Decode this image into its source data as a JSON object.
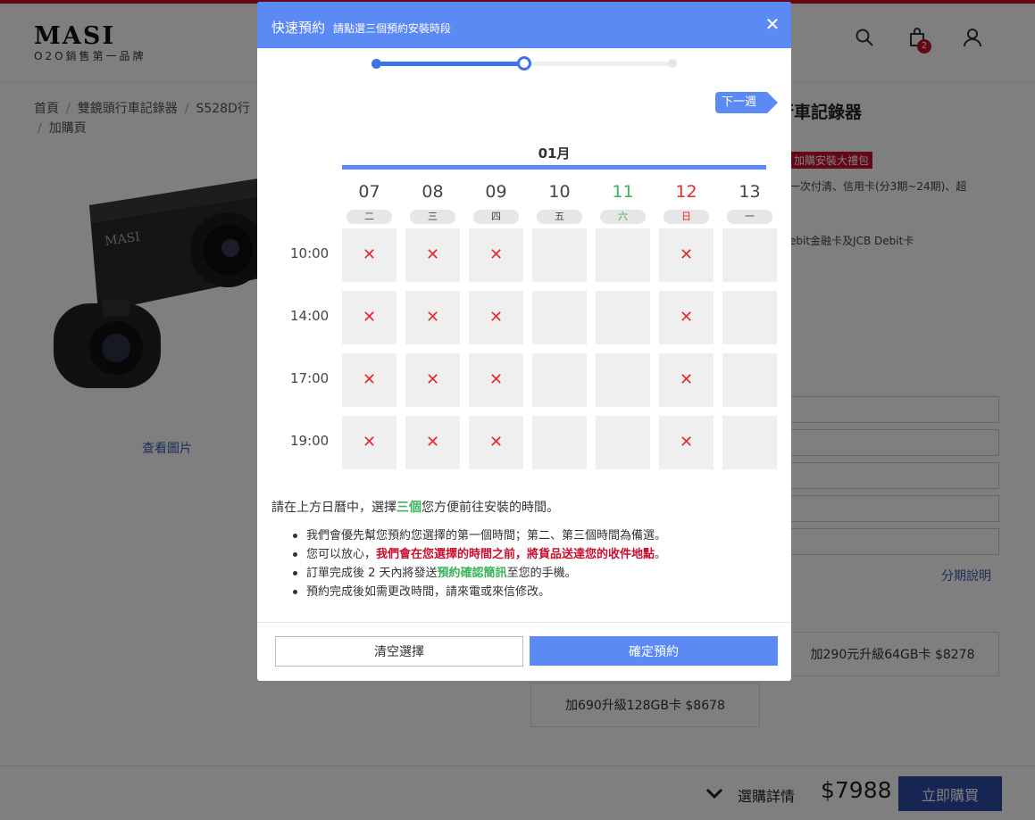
{
  "site": {
    "logo_text": "MASI",
    "logo_sub": "O2O銷售第一品牌",
    "cart_count": "2"
  },
  "breadcrumb": {
    "home": "首頁",
    "category": "雙鏡頭行車記錄器",
    "product": "S528D行",
    "current": "加購頁"
  },
  "product": {
    "view_photos": "查看圖片",
    "title": "行車記錄器",
    "promo": "加購安裝大禮包",
    "payment_note1": "一次付清、信用卡(分3期~24期)、超",
    "payment_note2": "ebit金融卡及JCB Debit卡",
    "installment_link": "分期說明",
    "option_64": "加290元升級64GB卡 $8278",
    "option_128": "加690升級128GB卡 $8678"
  },
  "bottom_bar": {
    "details_label": "選購詳情",
    "total": "$7988",
    "buy_now": "立即購買"
  },
  "modal": {
    "title": "快速預約",
    "subtitle": "請點選三個預約安裝時段",
    "close_symbol": "✕",
    "progress_fraction": 0.5,
    "next_week": "下一週",
    "month": "01月",
    "days": [
      {
        "num": "07",
        "weekday": "二",
        "color": "#444444"
      },
      {
        "num": "08",
        "weekday": "三",
        "color": "#444444"
      },
      {
        "num": "09",
        "weekday": "四",
        "color": "#444444"
      },
      {
        "num": "10",
        "weekday": "五",
        "color": "#444444"
      },
      {
        "num": "11",
        "weekday": "六",
        "color": "#3bb35b"
      },
      {
        "num": "12",
        "weekday": "日",
        "color": "#e52b2b"
      },
      {
        "num": "13",
        "weekday": "一",
        "color": "#444444"
      }
    ],
    "times": [
      "10:00",
      "14:00",
      "17:00",
      "19:00"
    ],
    "unavailable_mark": "✕",
    "unavailable": [
      [
        true,
        true,
        true,
        false,
        false,
        true,
        false
      ],
      [
        true,
        true,
        true,
        false,
        false,
        true,
        false
      ],
      [
        true,
        true,
        true,
        false,
        false,
        true,
        false
      ],
      [
        true,
        true,
        true,
        false,
        false,
        true,
        false
      ]
    ],
    "instruction_pre": "請在上方日曆中，選擇",
    "instruction_highlight": "三個",
    "instruction_post": "您方便前往安裝的時間。",
    "note1": "我們會優先幫您預約您選擇的第一個時間；第二、第三個時間為備選。",
    "note2_pre": "您可以放心，",
    "note2_highlight": "我們會在您選擇的時間之前，將貨品送達您的收件地點",
    "note2_post": "。",
    "note3_pre": "訂單完成後 2 天內將發送",
    "note3_highlight": "預約確認簡訊",
    "note3_post": "至您的手機。",
    "note4": "預約完成後如需更改時間，請來電或來信修改。",
    "clear_button": "清空選擇",
    "confirm_button": "確定預約"
  }
}
